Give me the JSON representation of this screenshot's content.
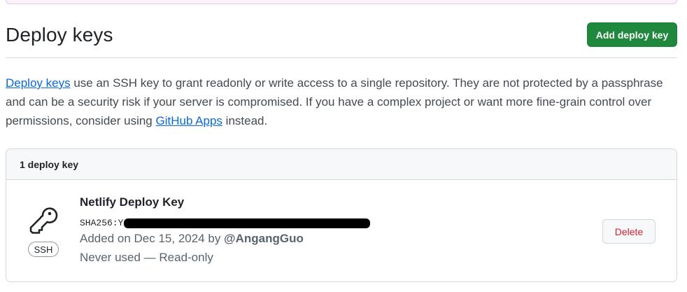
{
  "header": {
    "title": "Deploy keys",
    "add_button_label": "Add deploy key"
  },
  "description": {
    "link1": "Deploy keys",
    "text1": " use an SSH key to grant readonly or write access to a single repository. They are not protected by a passphrase and can be a security risk if your server is compromised. If you have a complex project or want more fine-grain control over permissions, consider using ",
    "link2": "GitHub Apps",
    "text2": " instead."
  },
  "keys": {
    "count_label": "1 deploy key",
    "items": [
      {
        "title": "Netlify Deploy Key",
        "badge": "SSH",
        "fingerprint": "SHA256:Y...",
        "added_prefix": "Added on Dec 15, 2024 by ",
        "added_by": "@AngangGuo",
        "usage": "Never used — Read-only",
        "delete_label": "Delete",
        "icon": "key-icon"
      }
    ]
  },
  "colors": {
    "primary_button": "#1f883d",
    "link": "#0969da",
    "danger": "#cf222e"
  }
}
